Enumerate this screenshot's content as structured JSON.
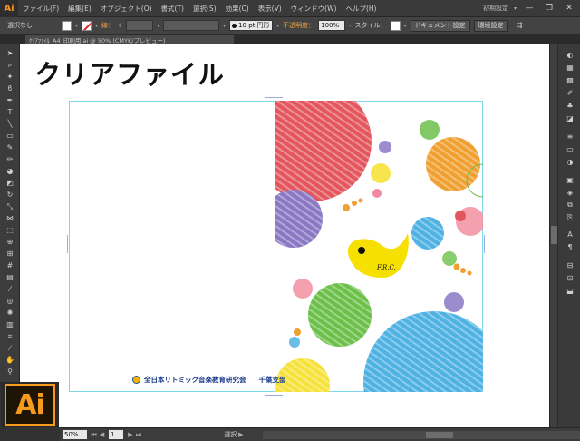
{
  "app": {
    "logo": "Ai"
  },
  "menu": {
    "items": [
      "ファイル(F)",
      "編集(E)",
      "オブジェクト(O)",
      "書式(T)",
      "選択(S)",
      "効果(C)",
      "表示(V)",
      "ウィンドウ(W)",
      "ヘルプ(H)"
    ],
    "workspace": "初期設定",
    "workspace_dropdown": "▾",
    "window_controls": {
      "minimize": "—",
      "restore": "❐",
      "close": "✕"
    }
  },
  "control_bar": {
    "selection_status": "選択なし",
    "stroke_label": "線：",
    "brush_size": "10 pt",
    "brush_shape": "円形",
    "opacity_label": "不透明度：",
    "opacity_value": "100%",
    "style_label": "スタイル：",
    "document_setup_button": "ドキュメント設定",
    "preferences_button": "環境設定"
  },
  "tabs": {
    "document_tab": "ｸﾘｱﾌｧｲﾙ_A4_印刷用.ai @ 50% (CMYK/プレビュー)"
  },
  "canvas": {
    "title": "クリアファイル",
    "logo_text": "全日本リトミック音楽教育研究会",
    "branch_text": "千葉支部",
    "bird_text": "F.R.C."
  },
  "status_bar": {
    "zoom": "50%",
    "page": "1",
    "status": "選択"
  },
  "badge": {
    "text": "Ai"
  },
  "colors": {
    "accent_orange": "#f79a1d",
    "guide_cyan": "#7fd8e8",
    "circle_red": "#e4565d",
    "circle_purple": "#8a78c4",
    "circle_blue": "#4fb2e3",
    "circle_green": "#6cc04a",
    "circle_orange": "#f0a030",
    "circle_yellow": "#f6e23a"
  },
  "tool_icons": [
    "selection-icon",
    "direct-selection-icon",
    "magic-wand-icon",
    "lasso-icon",
    "pen-icon",
    "type-icon",
    "line-icon",
    "rectangle-icon",
    "paintbrush-icon",
    "pencil-icon",
    "blob-brush-icon",
    "eraser-icon",
    "rotate-icon",
    "scale-icon",
    "width-icon",
    "free-transform-icon",
    "shape-builder-icon",
    "perspective-icon",
    "mesh-icon",
    "gradient-icon",
    "eyedropper-icon",
    "blend-icon",
    "symbol-sprayer-icon",
    "graph-icon",
    "artboard-icon",
    "slice-icon",
    "hand-icon",
    "zoom-icon"
  ],
  "panel_icons": [
    "color-panel-icon",
    "color-guide-icon",
    "swatches-icon",
    "brushes-icon",
    "symbols-icon",
    "graphic-styles-icon",
    "stroke-icon",
    "gradient-panel-icon",
    "transparency-icon",
    "appearance-icon",
    "layers-icon",
    "artboards-icon",
    "links-icon",
    "character-icon",
    "paragraph-icon",
    "align-icon",
    "pathfinder-icon",
    "transform-icon"
  ]
}
